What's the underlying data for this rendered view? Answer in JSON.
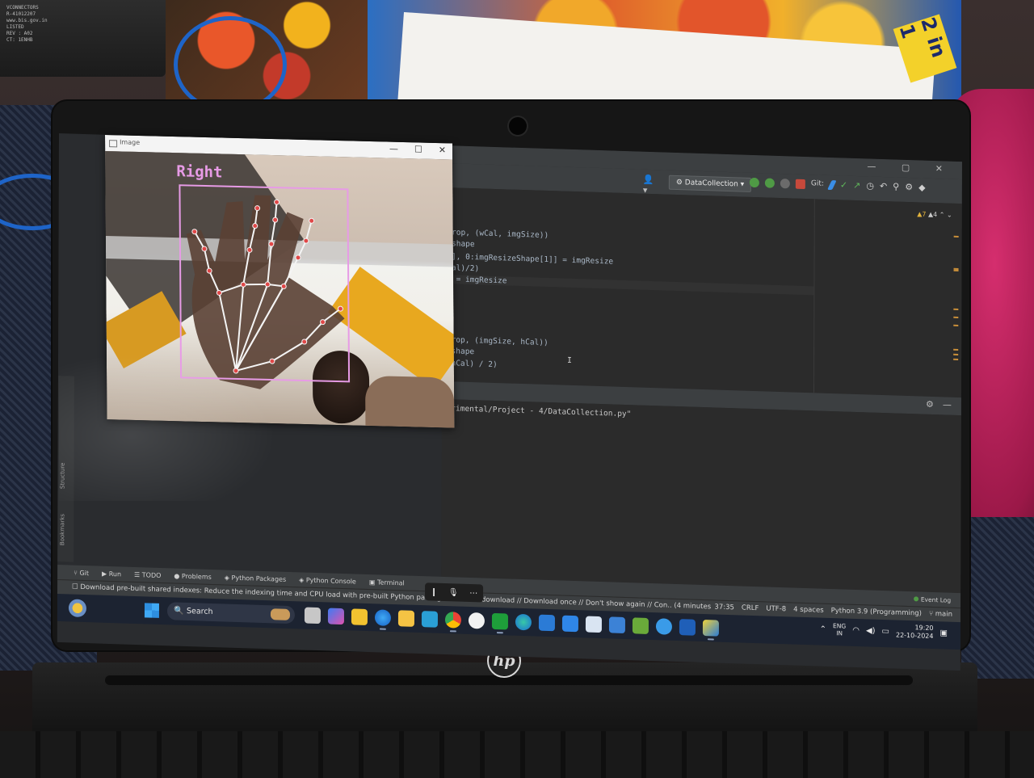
{
  "adapter": {
    "lines": [
      "VCONNECTORS",
      "R-41012207",
      "www.bis.gov.in",
      "LISTED",
      "REV : A02",
      "CT: 1ENHB"
    ]
  },
  "book": {
    "label": "2 in 1"
  },
  "image_window": {
    "title": "Image",
    "hand_label": "Right",
    "controls": {
      "minimize": "—",
      "maximize": "☐",
      "close": "✕"
    }
  },
  "ide": {
    "run_config": "DataCollection",
    "inspection": {
      "warnings": "▲7",
      "weak": "▲4"
    },
    "code_lines": [
      "gCrop, (wCal, imgSize))",
      "e.shape",
      "[0], 0:imgResizeShape[1]] = imgResize",
      "wCal)/2)",
      "p] = imgResize",
      "",
      "",
      "",
      "",
      "gCrop, (imgSize, hCal))",
      "e.shape",
      "- hCal) / 2)"
    ],
    "run_output": "perimental/Project - 4/DataCollection.py\"",
    "side_tabs": [
      "Structure",
      "Bookmarks"
    ],
    "tool_tabs": [
      "Git",
      "Run",
      "TODO",
      "Problems",
      "Python Packages",
      "Python Console",
      "Terminal"
    ],
    "status_message": "Download pre-built shared indexes: Reduce the indexing time and CPU load with pre-built Python packages shared",
    "status_message_tail": "download // Download once // Don't show again // Con.. (4 minutes",
    "event_log": "Event Log",
    "status_right": [
      "37:35",
      "CRLF",
      "UTF-8",
      "4 spaces",
      "Python 3.9 (Programming)",
      "main"
    ]
  },
  "taskbar": {
    "search_label": "Search",
    "lang_top": "ENG",
    "lang_bottom": "IN",
    "time": "19:20",
    "date": "22-10-2024"
  },
  "brand": "hp"
}
